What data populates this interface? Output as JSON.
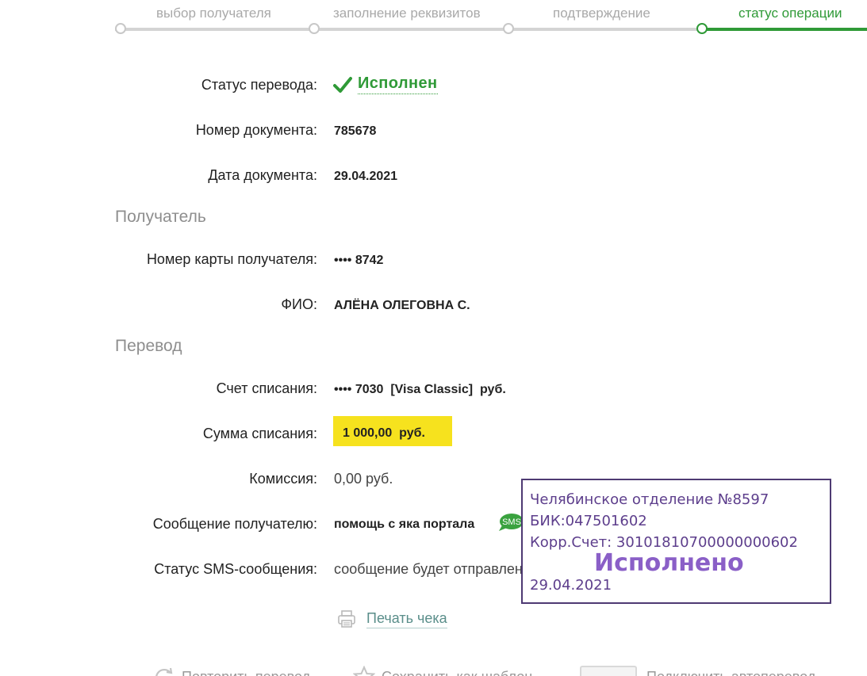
{
  "steps": [
    {
      "label": "выбор получателя",
      "active": false
    },
    {
      "label": "заполнение реквизитов",
      "active": false
    },
    {
      "label": "подтверждение",
      "active": false
    },
    {
      "label": "статус операции",
      "active": true
    }
  ],
  "status": {
    "label": "Статус перевода:",
    "value": "Исполнен"
  },
  "document": {
    "number_label": "Номер документа:",
    "number": "785678",
    "date_label": "Дата документа:",
    "date": "29.04.2021"
  },
  "recipient": {
    "section": "Получатель",
    "card_label": "Номер карты получателя:",
    "card": "•••• 8742",
    "name_label": "ФИО:",
    "name": "АЛЁНА ОЛЕГОВНА С."
  },
  "transfer": {
    "section": "Перевод",
    "account_label": "Счет списания:",
    "account": "•••• 7030  [Visa Classic]  руб.",
    "amount_label": "Сумма списания:",
    "amount": "1 000,00  руб.",
    "fee_label": "Комиссия:",
    "fee": "0,00 руб.",
    "message_label": "Сообщение получателю:",
    "message": "помощь с яка портала",
    "sms_label": "Статус SMS-сообщения:",
    "sms_status": "сообщение будет отправлено",
    "sms_icon_text": "SMS"
  },
  "print": {
    "label": "Печать чека"
  },
  "stamp": {
    "branch": "Челябинское отделение №8597",
    "bik": "БИК:047501602",
    "corr": "Корр.Счет: 30101810700000000602",
    "executed": "Исполнено",
    "date": "29.04.2021"
  },
  "actions": {
    "repeat": "Повторить перевод",
    "template": "Сохранить как шаблон",
    "auto": "Подключить автоперевод"
  },
  "colors": {
    "accent": "#2f9a37",
    "highlight": "#f6e21e",
    "stamp": "#5d3e8c"
  }
}
